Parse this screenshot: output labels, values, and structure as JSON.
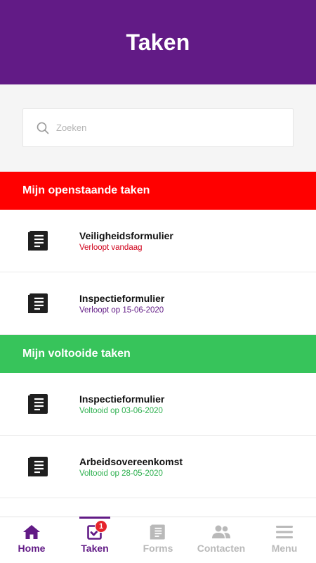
{
  "header": {
    "title": "Taken"
  },
  "search": {
    "placeholder": "Zoeken"
  },
  "colors": {
    "brand": "#621b86",
    "open_section": "#ff0000",
    "done_section": "#37c45b",
    "due_today": "#d0021b",
    "due_date": "#621b86",
    "completed": "#2eb04f"
  },
  "sections": {
    "open": {
      "title": "Mijn openstaande taken",
      "items": [
        {
          "title": "Veiligheidsformulier",
          "subtitle": "Verloopt vandaag",
          "icon": "document-list-icon"
        },
        {
          "title": "Inspectieformulier",
          "subtitle": "Verloopt op 15-06-2020",
          "icon": "document-list-icon"
        }
      ]
    },
    "done": {
      "title": "Mijn voltooide taken",
      "items": [
        {
          "title": "Inspectieformulier",
          "subtitle": "Voltooid op 03-06-2020",
          "icon": "document-list-icon"
        },
        {
          "title": "Arbeidsovereenkomst",
          "subtitle": "Voltooid op 28-05-2020",
          "icon": "document-list-icon"
        }
      ]
    }
  },
  "nav": {
    "home": {
      "label": "Home",
      "icon": "house-icon"
    },
    "tasks": {
      "label": "Taken",
      "icon": "checkbox-icon",
      "badge": "1"
    },
    "forms": {
      "label": "Forms",
      "icon": "document-icon"
    },
    "contacts": {
      "label": "Contacten",
      "icon": "people-icon"
    },
    "menu": {
      "label": "Menu",
      "icon": "hamburger-icon"
    }
  }
}
